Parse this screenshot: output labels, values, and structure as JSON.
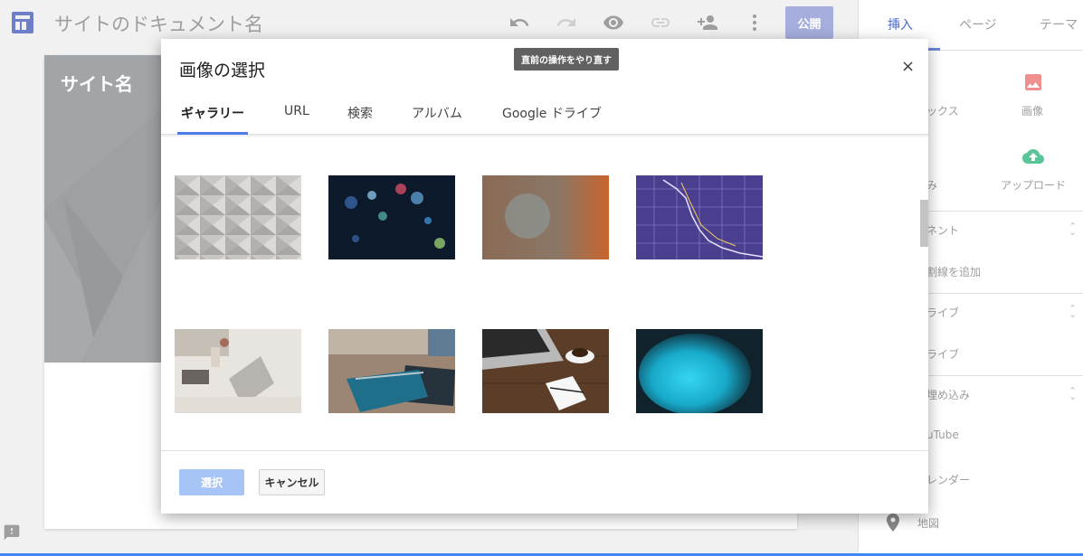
{
  "app": {
    "doc_title": "サイトのドキュメント名",
    "publish_label": "公開",
    "site_name": "サイト名"
  },
  "toolbar": {
    "icons": [
      "undo-icon",
      "redo-icon",
      "preview-icon",
      "link-icon",
      "share-icon",
      "more-icon"
    ]
  },
  "tooltip": {
    "text": "直前の操作をやり直す"
  },
  "right_panel": {
    "tabs": [
      {
        "label": "挿入",
        "active": true
      },
      {
        "label": "ページ",
        "active": false
      },
      {
        "label": "テーマ",
        "active": false
      }
    ],
    "items": {
      "textbox_partial": "ックス",
      "image": "画像",
      "embed_partial": "み",
      "upload": "アップロード",
      "content_partial": "ネント",
      "add_divider_partial": "割線を追加",
      "drive_header_partial": "ライブ",
      "drive_item_partial": "ライブ",
      "embed_header_partial": "埋め込み",
      "youtube_partial": "uTube",
      "calendar_partial": "レンダー",
      "map": "地図"
    }
  },
  "modal": {
    "title": "画像の選択",
    "close_label": "×",
    "tabs": [
      {
        "label": "ギャラリー",
        "active": true
      },
      {
        "label": "URL",
        "active": false
      },
      {
        "label": "検索",
        "active": false
      },
      {
        "label": "アルバム",
        "active": false
      },
      {
        "label": "Google ドライブ",
        "active": false
      }
    ],
    "gallery": [
      "geometric-pattern-image",
      "city-bokeh-night-image",
      "blurred-orange-bokeh-image",
      "stock-chart-screen-image",
      "office-desk-laptop-image",
      "tablet-notebook-desk-image",
      "laptop-coffee-notebook-image",
      "blue-glow-abstract-image"
    ],
    "select_label": "選択",
    "cancel_label": "キャンセル"
  },
  "colors": {
    "accent": "#4d7ce8",
    "publish_bg": "#a5aedc",
    "select_bg": "#a7c4f6",
    "hero_bg": "#9ea1a4"
  }
}
